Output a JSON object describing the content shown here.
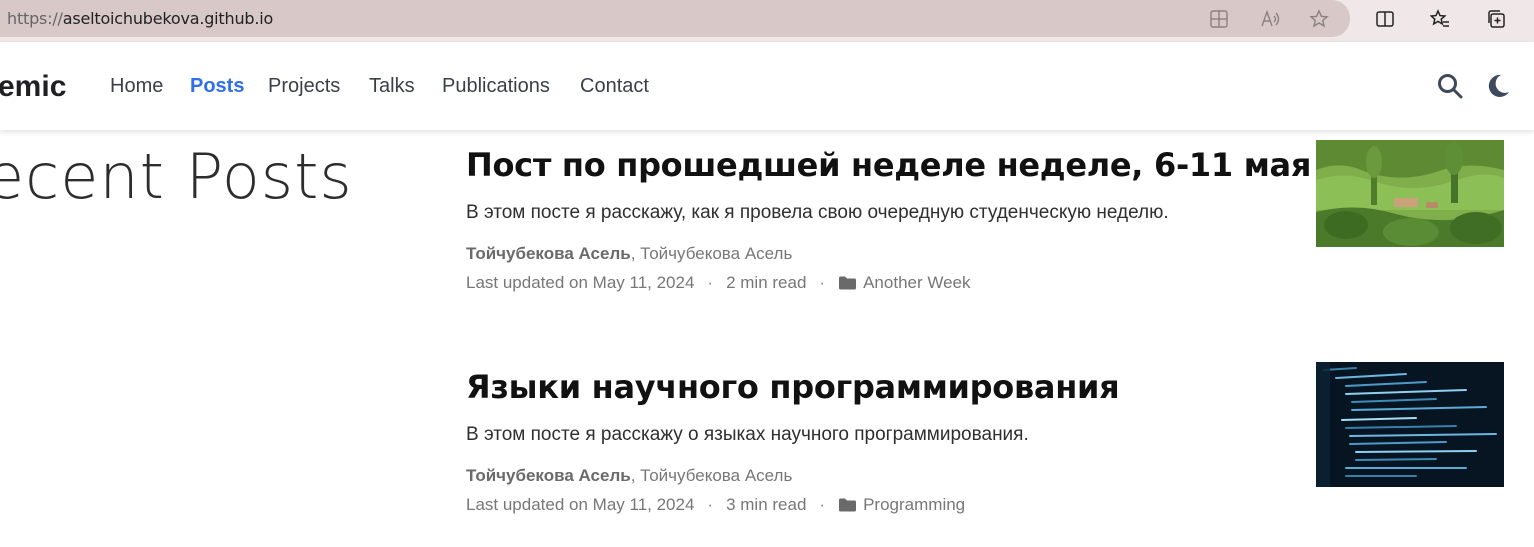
{
  "browser": {
    "url_proto": "https://",
    "url_host": "aseltoichubekova.github.io",
    "icons": [
      "app-grid-icon",
      "read-aloud-icon",
      "favorite-star-icon",
      "split-screen-icon",
      "favorites-list-icon",
      "collections-icon"
    ]
  },
  "navbar": {
    "brand": "emic",
    "links": [
      {
        "label": "Home",
        "active": false
      },
      {
        "label": "Posts",
        "active": true
      },
      {
        "label": "Projects",
        "active": false
      },
      {
        "label": "Talks",
        "active": false
      },
      {
        "label": "Publications",
        "active": false
      },
      {
        "label": "Contact",
        "active": false
      }
    ],
    "icons": [
      "search-icon",
      "dark-mode-moon-icon"
    ],
    "accent_color": "#2f6fe8"
  },
  "page": {
    "heading": "ecent Posts"
  },
  "posts": [
    {
      "title": "Пост по прошедшей неделе неделе, 6-11 мая",
      "summary": "В этом посте я расскажу, как я провела свою очередную студенческую неделю.",
      "author_bold": "Тойчубекова Асель",
      "author_rest": ", Тойчубекова Асель",
      "updated": "Last updated on May 11, 2024",
      "read_time": "2 min read",
      "category": "Another Week",
      "thumbnail": "green-hills-landscape"
    },
    {
      "title": "Языки научного программирования",
      "summary": "В этом посте я расскажу о языках научного программирования.",
      "author_bold": "Тойчубекова Асель",
      "author_rest": ", Тойчубекова Асель",
      "updated": "Last updated on May 11, 2024",
      "read_time": "3 min read",
      "category": "Programming",
      "thumbnail": "code-on-screen"
    }
  ],
  "meta_separator": "·"
}
